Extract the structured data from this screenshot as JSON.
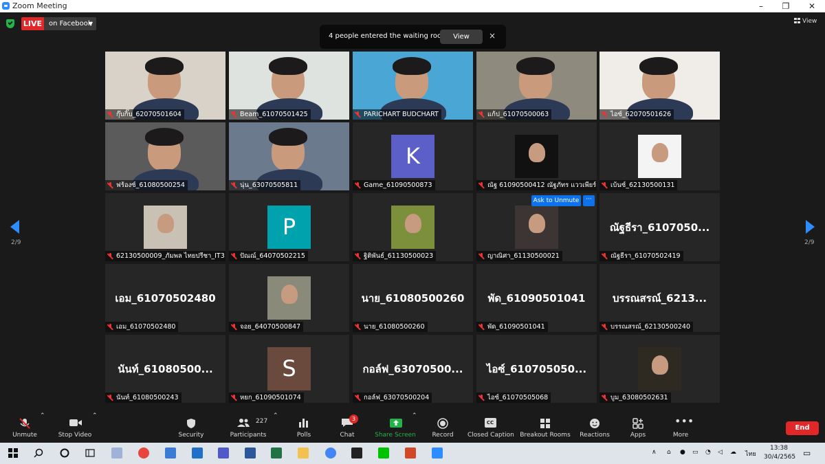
{
  "window": {
    "title": "Zoom Meeting",
    "minimize": "–",
    "maximize": "❐",
    "close": "✕"
  },
  "live": {
    "badge": "LIVE",
    "destination": "on Facebook"
  },
  "notification": {
    "message": "4 people entered the waiting room",
    "view_label": "View",
    "close": "×"
  },
  "view_toggle": "View",
  "pager": {
    "left": "2/9",
    "right": "2/9"
  },
  "participants": [
    {
      "name": "กุ๊บกิ๊บ_62070501604",
      "kind": "video",
      "bg": "#d9d2c8"
    },
    {
      "name": "Beam_61070501425",
      "kind": "video",
      "bg": "#dfe3e0"
    },
    {
      "name": "PARICHART BUDCHART",
      "kind": "video",
      "bg": "#4aa6d4"
    },
    {
      "name": "แก้ป_61070500063",
      "kind": "video",
      "bg": "#8e8a7d"
    },
    {
      "name": "ไอซ์_62070501626",
      "kind": "video",
      "bg": "#f0ece8"
    },
    {
      "name": "ฟร้องซ์_61080500254",
      "kind": "video",
      "bg": "#5b5b5b"
    },
    {
      "name": "นุ่น_63070505811",
      "kind": "video",
      "bg": "#6b7a8d"
    },
    {
      "name": "Game_61090500873",
      "kind": "avatar",
      "letter": "K",
      "bg": "#5b5fc7"
    },
    {
      "name": "ณัฐ 61090500412 ณัฐภัทร แววเพียร์",
      "kind": "photo",
      "bg": "#111111"
    },
    {
      "name": "เบ้นซ์_62130500131",
      "kind": "photo",
      "bg": "#f4f4f4"
    },
    {
      "name": "62130500009_ภัมพล ไทยปรีชา_IT3",
      "kind": "photo",
      "bg": "#c9c1b4"
    },
    {
      "name": "ปัณณ์_64070502215",
      "kind": "avatar",
      "letter": "P",
      "bg": "#00a2ad"
    },
    {
      "name": "ฐิติพันธ์_61130500023",
      "kind": "photo",
      "bg": "#7c8f3b"
    },
    {
      "name": "ญาณิศา_61130500021",
      "kind": "photo",
      "bg": "#3d3434"
    },
    {
      "name": "ณัฐธีรา_61070502419",
      "kind": "name",
      "display": "ณัฐธีรา_6107050..."
    },
    {
      "name": "เอม_61070502480",
      "kind": "name",
      "display": "เอม_61070502480"
    },
    {
      "name": "จอย_64070500847",
      "kind": "photo",
      "bg": "#8a8a7a"
    },
    {
      "name": "นาย_61080500260",
      "kind": "name",
      "display": "นาย_61080500260"
    },
    {
      "name": "พัด_61090501041",
      "kind": "name",
      "display": "พัด_61090501041"
    },
    {
      "name": "บรรณสรณ์_62130500240",
      "kind": "name",
      "display": "บรรณสรณ์_6213..."
    },
    {
      "name": "นันท์_61080500243",
      "kind": "name",
      "display": "นันท์_61080500..."
    },
    {
      "name": "หยก_61090501074",
      "kind": "avatar",
      "letter": "S",
      "bg": "#6b4a3e"
    },
    {
      "name": "กอล์ฟ_63070500204",
      "kind": "name",
      "display": "กอล์ฟ_63070500..."
    },
    {
      "name": "ไอซ์_61070505068",
      "kind": "name",
      "display": "ไอซ์_610705050..."
    },
    {
      "name": "บูม_63080502631",
      "kind": "photo",
      "bg": "#2e2a22"
    }
  ],
  "hover_actions": {
    "ask_to_unmute": "Ask to Unmute",
    "more": "···"
  },
  "toolbar": {
    "unmute": "Unmute",
    "stop_video": "Stop Video",
    "security": "Security",
    "participants": "Participants",
    "participant_count": "227",
    "polls": "Polls",
    "chat": "Chat",
    "chat_badge": "3",
    "share_screen": "Share Screen",
    "record": "Record",
    "closed_caption": "Closed Caption",
    "closed_caption_icon": "CC",
    "breakout_rooms": "Breakout Rooms",
    "reactions": "Reactions",
    "apps": "Apps",
    "more": "More",
    "end": "End"
  },
  "taskbar": {
    "time": "13:38",
    "date": "30/4/2565",
    "lang": "ไทย"
  },
  "colors": {
    "zoom_blue": "#2D8CFF",
    "live_red": "#e02828",
    "share_green": "#23b34a"
  }
}
